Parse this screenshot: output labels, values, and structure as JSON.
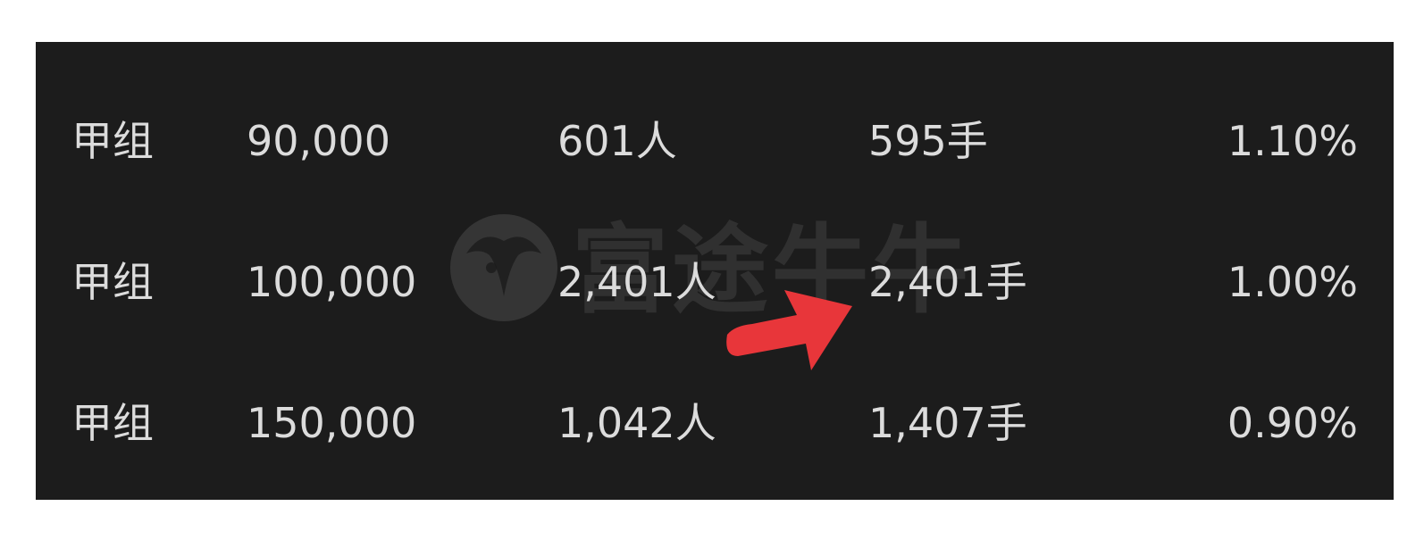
{
  "table": {
    "rows": [
      {
        "group": "甲组",
        "amount": "90,000",
        "people": "601人",
        "lots": "595手",
        "rate": "1.10%"
      },
      {
        "group": "甲组",
        "amount": "100,000",
        "people": "2,401人",
        "lots": "2,401手",
        "rate": "1.00%"
      },
      {
        "group": "甲组",
        "amount": "150,000",
        "people": "1,042人",
        "lots": "1,407手",
        "rate": "0.90%"
      }
    ]
  },
  "watermark": {
    "logo_icon": "futu-bull-logo-icon",
    "text": "富途牛牛"
  },
  "annotation": {
    "icon": "red-arrow-icon",
    "color": "#e8363a"
  },
  "colors": {
    "panel_background": "#1c1c1c",
    "text": "#dcdcdc",
    "page_background": "#ffffff"
  }
}
